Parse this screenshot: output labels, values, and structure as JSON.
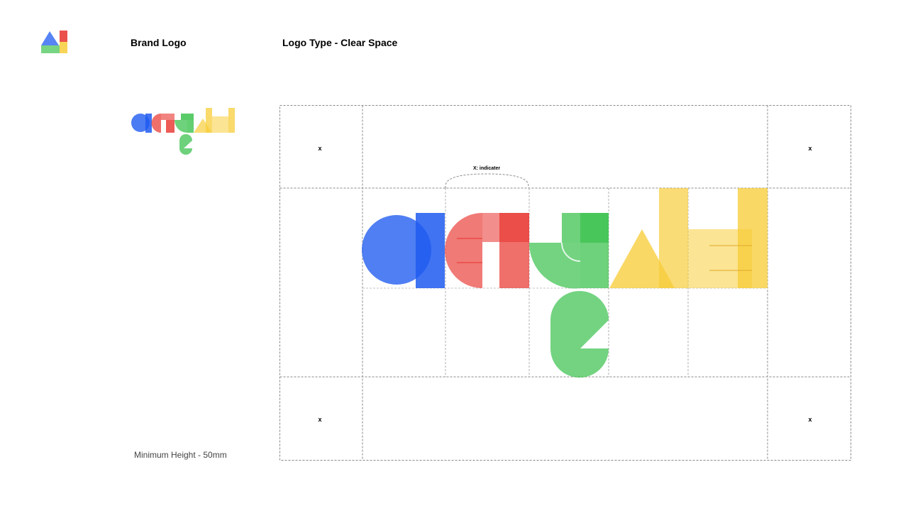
{
  "header": {
    "brand_title": "Brand Logo",
    "page_title": "Logo Type - Clear Space"
  },
  "brand_logo": {
    "caption": "Minimum Height - 50mm"
  },
  "clear_space": {
    "x_label": "x",
    "indicator_label": "X: indicater"
  },
  "colors": {
    "blue": "#1f5bf0",
    "red": "#e8322c",
    "green": "#3dc24f",
    "yellow": "#f7cd3a",
    "guide": "#8a8a8a"
  },
  "icons": {
    "corner_logo": "triangle-square-block-icon",
    "wordmark": "geometric-wordmark-logo"
  }
}
